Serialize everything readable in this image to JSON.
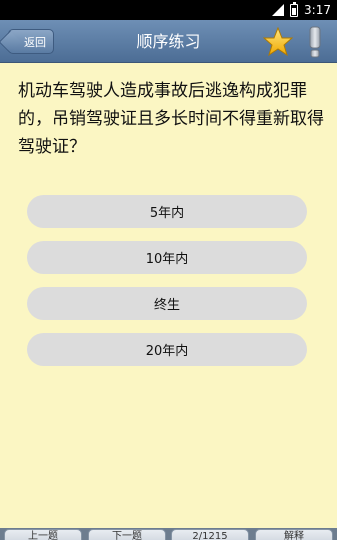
{
  "status_bar": {
    "time": "3:17"
  },
  "header": {
    "back_label": "返回",
    "title": "顺序练习"
  },
  "question": {
    "text": "机动车驾驶人造成事故后逃逸构成犯罪的，吊销驾驶证且多长时间不得重新取得驾驶证？",
    "options": [
      "5年内",
      "10年内",
      "终生",
      "20年内"
    ]
  },
  "toolbar": {
    "buttons": [
      "上一题",
      "下一题",
      "2/1215",
      "解释"
    ]
  },
  "colors": {
    "title_bar": "#5a7ba3",
    "question_bg": "#fbf6c3",
    "option_bg": "#dcdcdc",
    "star": "#f5c518"
  }
}
